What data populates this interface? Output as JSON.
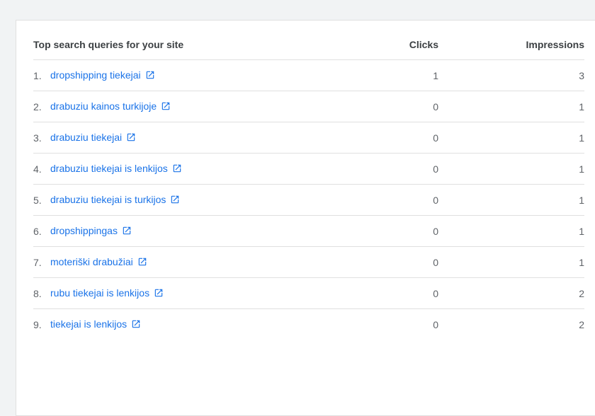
{
  "header": {
    "query_label": "Top search queries for your site",
    "clicks_label": "Clicks",
    "impressions_label": "Impressions"
  },
  "rows": [
    {
      "rank": "1.",
      "query": "dropshipping tiekejai",
      "clicks": "1",
      "impressions": "3"
    },
    {
      "rank": "2.",
      "query": "drabuziu kainos turkijoje",
      "clicks": "0",
      "impressions": "1"
    },
    {
      "rank": "3.",
      "query": "drabuziu tiekejai",
      "clicks": "0",
      "impressions": "1"
    },
    {
      "rank": "4.",
      "query": "drabuziu tiekejai is lenkijos",
      "clicks": "0",
      "impressions": "1"
    },
    {
      "rank": "5.",
      "query": "drabuziu tiekejai is turkijos",
      "clicks": "0",
      "impressions": "1"
    },
    {
      "rank": "6.",
      "query": "dropshippingas",
      "clicks": "0",
      "impressions": "1"
    },
    {
      "rank": "7.",
      "query": "moteriški drabužiai",
      "clicks": "0",
      "impressions": "1"
    },
    {
      "rank": "8.",
      "query": "rubu tiekejai is lenkijos",
      "clicks": "0",
      "impressions": "2"
    },
    {
      "rank": "9.",
      "query": "tiekejai is lenkijos",
      "clicks": "0",
      "impressions": "2"
    }
  ],
  "icons": {
    "external_link": "open-in-new-icon"
  },
  "colors": {
    "link": "#1a73e8",
    "text": "#5f6368",
    "header_text": "#3c4043",
    "divider": "#e0e0e0",
    "background": "#f1f3f4",
    "card": "#ffffff"
  }
}
